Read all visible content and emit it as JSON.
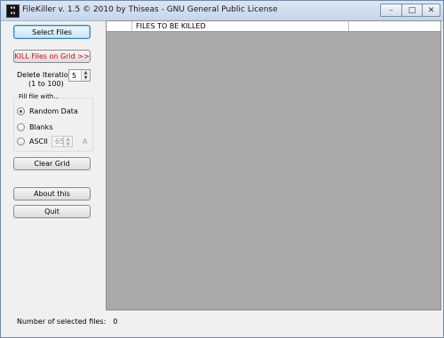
{
  "window": {
    "title": "FileKiller v. 1.5 © 2010 by Thiseas - GNU General Public License",
    "icon": "app-icon",
    "controls": {
      "minimize": "–",
      "maximize": "□",
      "close": "✕"
    }
  },
  "left_panel": {
    "select_files_label": "Select Files",
    "kill_files_label": "KILL Files on Grid >>",
    "delete_iterations_label": "Delete Iterations",
    "delete_iterations_range": "(1 to 100)",
    "delete_iterations_value": "5",
    "fill_group_label": "Fill file with...",
    "fill_options": [
      {
        "label": "Random Data",
        "checked": true
      },
      {
        "label": "Blanks",
        "checked": false
      },
      {
        "label": "ASCII",
        "checked": false
      }
    ],
    "ascii_value": "65",
    "ascii_char": "A",
    "clear_grid_label": "Clear Grid",
    "about_label": "About this",
    "quit_label": "Quit"
  },
  "grid": {
    "column_header": "FILES TO BE KILLED"
  },
  "status": {
    "selected_label": "Number of selected files:",
    "selected_count": "0"
  },
  "colors": {
    "kill_text": "#e00000",
    "grid_background": "#a9a9a9",
    "window_background": "#f0f0f0"
  }
}
